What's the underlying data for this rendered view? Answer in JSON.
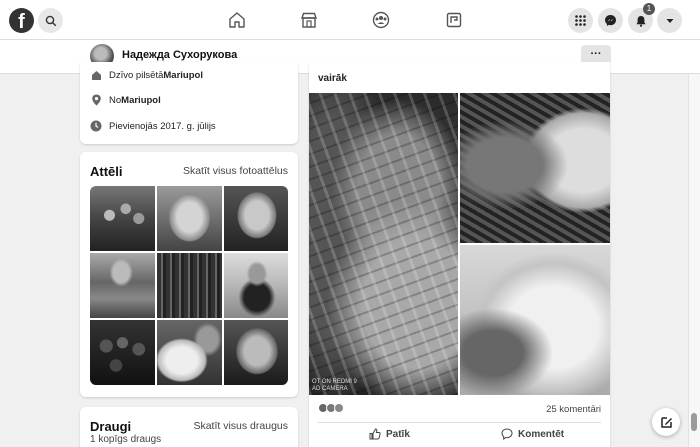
{
  "topnav": {
    "logo": "f",
    "icons": [
      "search-icon",
      "home-icon",
      "marketplace-icon",
      "groups-icon",
      "gaming-icon",
      "menu-grid-icon",
      "messenger-icon",
      "bell-icon",
      "chevron-down-icon"
    ],
    "notification_count": "1"
  },
  "profile_bar": {
    "name": "Надежда Сухорукова",
    "more_label": "···"
  },
  "intro": {
    "rows": [
      {
        "icon": "home-icon",
        "prefix": "Dzīvo pilsētā ",
        "value": "Mariupol"
      },
      {
        "icon": "location-pin-icon",
        "prefix": "No ",
        "value": "Mariupol"
      },
      {
        "icon": "clock-icon",
        "prefix": "Pievienojās 2017. g. jūlijs",
        "value": ""
      }
    ]
  },
  "photos": {
    "title": "Attēli",
    "link": "Skatīt visus fotoattēlus"
  },
  "friends": {
    "title": "Draugi",
    "link": "Skatīt visus draugus",
    "mutual": "1 kopīgs draugs"
  },
  "post": {
    "more_text": "vairāk",
    "watermark_line1": "OT ON REDMI 9",
    "watermark_line2": "AD CAMERA",
    "comments_count": "25 komentāri",
    "like_label": "Patīk",
    "comment_label": "Komentēt"
  },
  "colors": {
    "background": "#f0f0f0",
    "card": "#ffffff",
    "text": "#1c1c1c",
    "secondary_text": "#444444"
  }
}
